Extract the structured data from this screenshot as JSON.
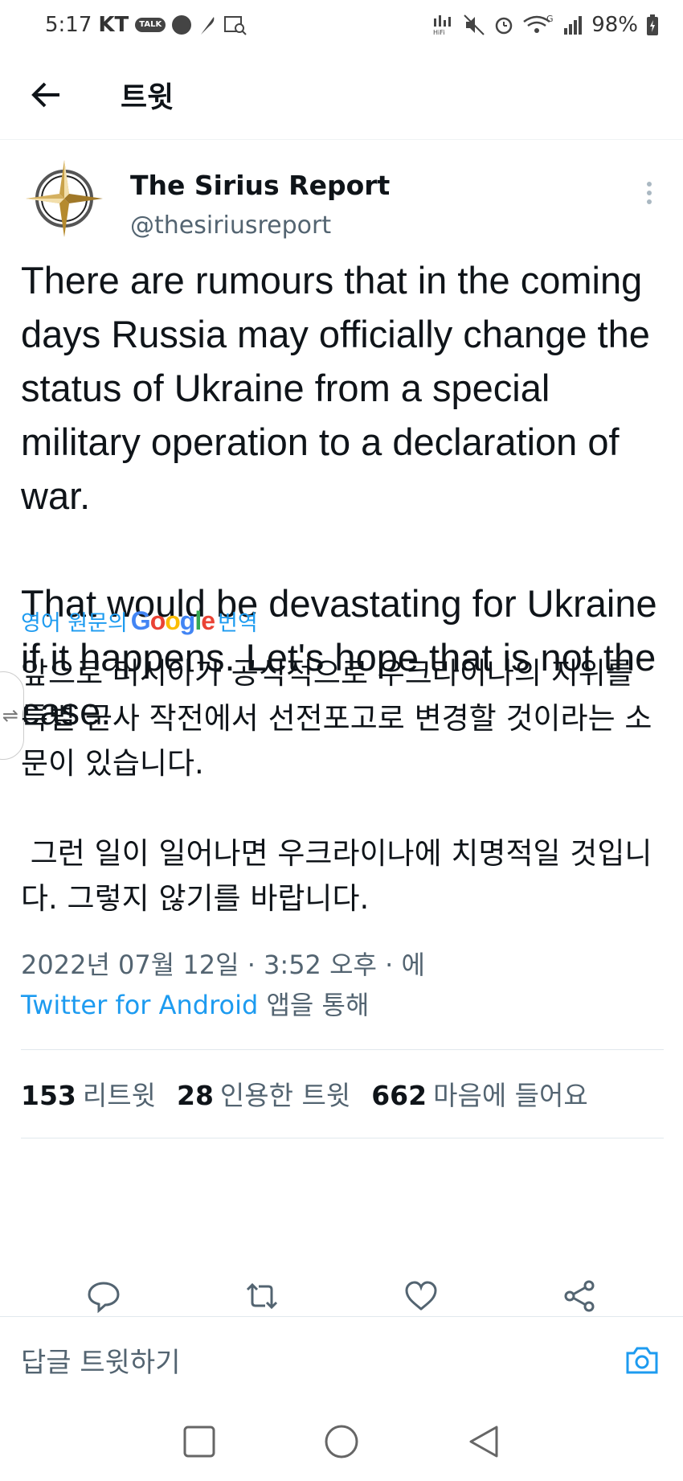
{
  "status_bar": {
    "time": "5:17",
    "carrier": "KT",
    "talk_badge": "TALK",
    "battery": "98%",
    "network": "G"
  },
  "header": {
    "title": "트윗"
  },
  "tweet": {
    "display_name": "The Sirius Report",
    "handle": "@thesiriusreport",
    "text": "There are rumours that in the coming days Russia may officially change the status of Ukraine from a special military operation to a declaration of war.\n\nThat would be devastating for Ukraine if it happens. Let's hope that is not the case.",
    "translate_prefix": "영어 원문의",
    "translate_brand": "Google",
    "translate_suffix": "번역",
    "translated_text": "앞으로 러시아가 공식적으로 우크라이나의 지위를 특별 군사 작전에서 선전포고로 변경할 것이라는 소문이 있습니다.\n\n 그런 일이 일어나면 우크라이나에 치명적일 것입니다. 그렇지 않기를 바랍니다.",
    "timestamp": "2022년 07월 12일 · 3:52 오후 · 에",
    "source_app": "Twitter for Android",
    "source_suffix": " 앱을 통해"
  },
  "stats": {
    "retweets_count": "153",
    "retweets_label": "리트윗",
    "quotes_count": "28",
    "quotes_label": "인용한 트윗",
    "likes_count": "662",
    "likes_label": "마음에 들어요"
  },
  "reply_bar": {
    "placeholder": "답글 트윗하기"
  },
  "colors": {
    "accent": "#1d9bf0",
    "text": "#0f1419",
    "secondary": "#536471"
  }
}
